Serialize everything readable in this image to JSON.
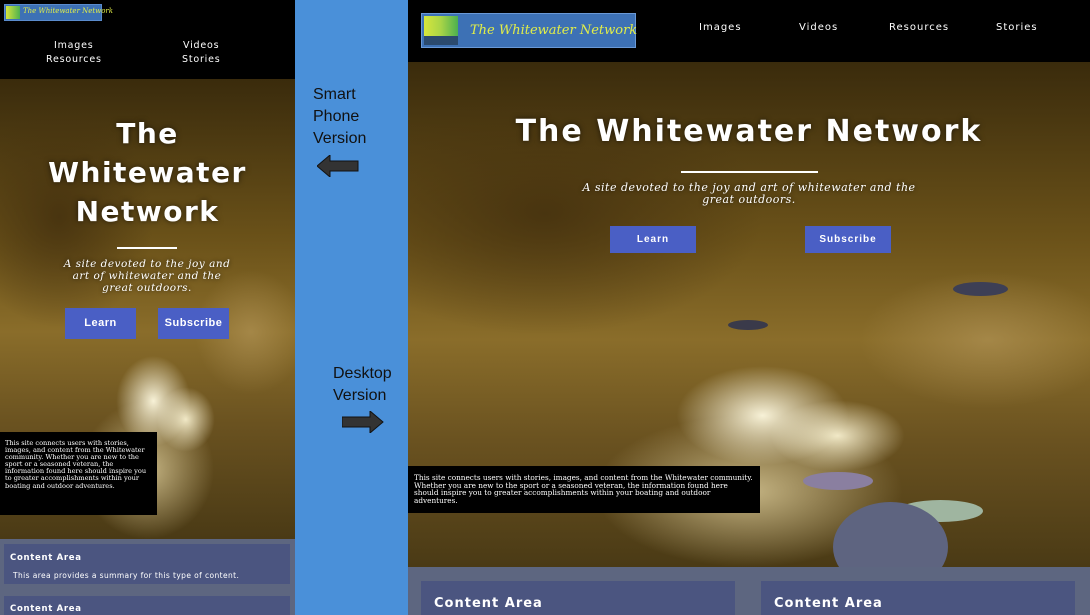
{
  "phone": {
    "logo_text": "The Whitewater Network",
    "nav": [
      "Images",
      "Videos",
      "Resources",
      "Stories"
    ],
    "title_lines": [
      "The",
      "Whitewater",
      "Network"
    ],
    "tagline": "A site devoted to the joy and art of whitewater and the great outdoors.",
    "learn_label": "Learn",
    "subscribe_label": "Subscribe",
    "info_text": "This site connects users with stories, images, and content from the Whitewater community. Whether you are new to the sport or a seasoned veteran, the information found here should inspire you to greater accomplishments within your boating and outdoor adventures.",
    "cards": [
      {
        "title": "Content Area",
        "desc": "This area provides a summary for this type of content."
      },
      {
        "title": "Content Area",
        "desc": ""
      }
    ]
  },
  "middle": {
    "phone_label": [
      "Smart",
      "Phone",
      "Version"
    ],
    "desktop_label": [
      "Desktop",
      "Version"
    ]
  },
  "desktop": {
    "logo_text": "The Whitewater Network",
    "nav": [
      "Images",
      "Videos",
      "Resources",
      "Stories"
    ],
    "title": "The Whitewater Network",
    "tagline": "A site devoted to the joy and art of whitewater and the great outdoors.",
    "learn_label": "Learn",
    "subscribe_label": "Subscribe",
    "info_text": "This site connects users with stories, images, and content from the Whitewater community. Whether you are new to the sport or a seasoned veteran, the information found here should inspire you to greater accomplishments within your boating and outdoor adventures.",
    "cards": [
      {
        "title": "Content Area"
      },
      {
        "title": "Content Area"
      }
    ]
  },
  "colors": {
    "accent_button": "#4a5fc5",
    "middle_panel": "#4a90d9",
    "footer": "#5d6680",
    "card": "#4b5580",
    "logo_text": "#e2ee48"
  }
}
